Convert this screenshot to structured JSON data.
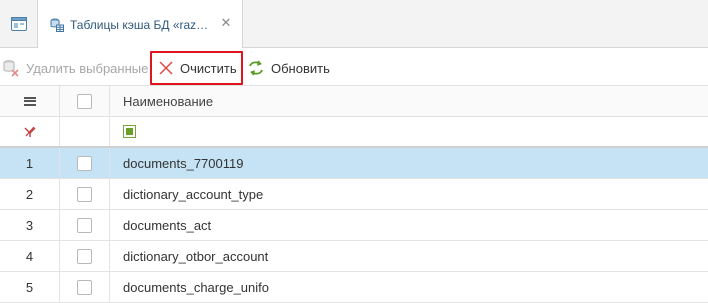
{
  "tabs": {
    "home_icon": "window-icon",
    "active_tab": {
      "title": "Таблицы кэша БД «raz…",
      "close_glyph": "✕",
      "icon": "table-cache-icon"
    }
  },
  "toolbar": {
    "delete_label": "Удалить выбранные",
    "clear_label": "Очистить",
    "refresh_label": "Обновить"
  },
  "grid": {
    "columns": [
      "",
      "",
      "Наименование"
    ],
    "rows": [
      {
        "num": "1",
        "name": "documents_7700119",
        "selected": true
      },
      {
        "num": "2",
        "name": "dictionary_account_type",
        "selected": false
      },
      {
        "num": "3",
        "name": "documents_act",
        "selected": false
      },
      {
        "num": "4",
        "name": "dictionary_otbor_account",
        "selected": false
      },
      {
        "num": "5",
        "name": "documents_charge_unifo",
        "selected": false
      }
    ]
  },
  "colors": {
    "highlight_border": "#e0141b",
    "selected_row": "#c5e3f4",
    "tab_title": "#2f5a7d"
  }
}
